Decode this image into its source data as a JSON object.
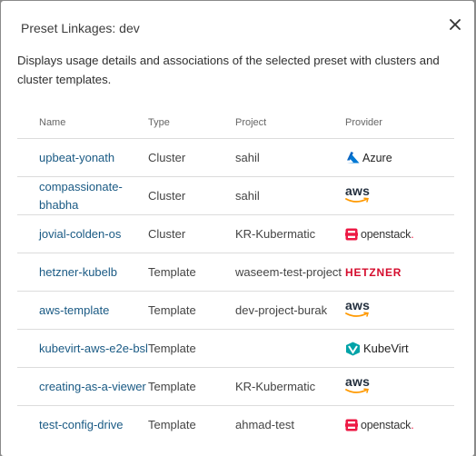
{
  "dialog": {
    "title": "Preset Linkages: dev",
    "close_icon": "close-icon",
    "description": "Displays usage details and associations of the selected preset with clusters and cluster templates."
  },
  "table": {
    "headers": {
      "name": "Name",
      "type": "Type",
      "project": "Project",
      "provider": "Provider"
    },
    "rows": [
      {
        "name": "upbeat-yonath",
        "type": "Cluster",
        "project": "sahil",
        "provider": "azure",
        "provider_label": "Azure"
      },
      {
        "name": "compassionate-bhabha",
        "type": "Cluster",
        "project": "sahil",
        "provider": "aws",
        "provider_label": "aws"
      },
      {
        "name": "jovial-colden-os",
        "type": "Cluster",
        "project": "KR-Kubermatic",
        "provider": "openstack",
        "provider_label": "openstack"
      },
      {
        "name": "hetzner-kubelb",
        "type": "Template",
        "project": "waseem-test-project",
        "provider": "hetzner",
        "provider_label": "HETZNER"
      },
      {
        "name": "aws-template",
        "type": "Template",
        "project": "dev-project-burak",
        "provider": "aws",
        "provider_label": "aws"
      },
      {
        "name": "kubevirt-aws-e2e-bsl",
        "type": "Template",
        "project": "",
        "provider": "kubevirt",
        "provider_label": "KubeVirt"
      },
      {
        "name": "creating-as-a-viewer",
        "type": "Template",
        "project": "KR-Kubermatic",
        "provider": "aws",
        "provider_label": "aws"
      },
      {
        "name": "test-config-drive",
        "type": "Template",
        "project": "ahmad-test",
        "provider": "openstack",
        "provider_label": "openstack"
      }
    ]
  },
  "colors": {
    "link": "#1a5a84",
    "azure": "#0078d4",
    "aws_orange": "#ff9900",
    "openstack_red": "#ed1944",
    "hetzner_red": "#d50c2d",
    "kubevirt_teal": "#00797f"
  }
}
